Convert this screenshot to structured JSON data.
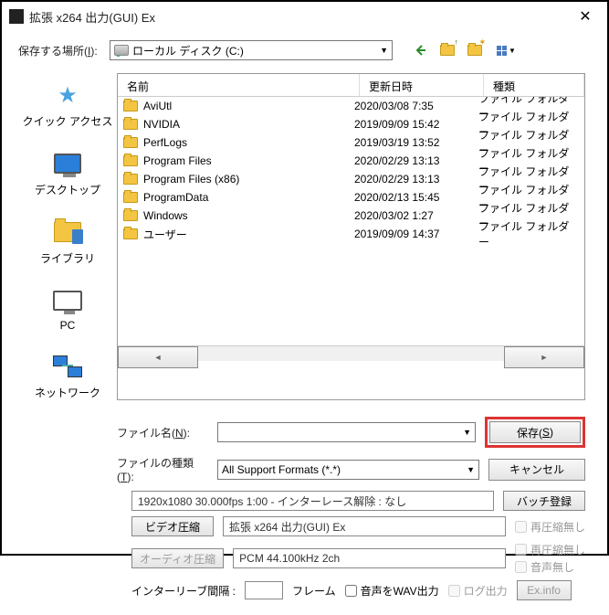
{
  "window": {
    "title": "拡張 x264 出力(GUI) Ex"
  },
  "savein": {
    "label_pre": "保存する場所(",
    "label_key": "I",
    "label_post": "):",
    "drive": "ローカル ディスク (C:)"
  },
  "places": {
    "quick": "クイック アクセス",
    "desktop": "デスクトップ",
    "libraries": "ライブラリ",
    "pc": "PC",
    "network": "ネットワーク"
  },
  "columns": {
    "name": "名前",
    "date": "更新日時",
    "type": "種類"
  },
  "files": [
    {
      "name": "AviUtl",
      "date": "2020/03/08 7:35",
      "type": "ファイル フォルダー"
    },
    {
      "name": "NVIDIA",
      "date": "2019/09/09 15:42",
      "type": "ファイル フォルダー"
    },
    {
      "name": "PerfLogs",
      "date": "2019/03/19 13:52",
      "type": "ファイル フォルダー"
    },
    {
      "name": "Program Files",
      "date": "2020/02/29 13:13",
      "type": "ファイル フォルダー"
    },
    {
      "name": "Program Files (x86)",
      "date": "2020/02/29 13:13",
      "type": "ファイル フォルダー"
    },
    {
      "name": "ProgramData",
      "date": "2020/02/13 15:45",
      "type": "ファイル フォルダー"
    },
    {
      "name": "Windows",
      "date": "2020/03/02 1:27",
      "type": "ファイル フォルダー"
    },
    {
      "name": "ユーザー",
      "date": "2019/09/09 14:37",
      "type": "ファイル フォルダー"
    }
  ],
  "filename": {
    "label_pre": "ファイル名(",
    "label_key": "N",
    "label_post": "):",
    "value": ""
  },
  "filetype": {
    "label_pre": "ファイルの種類(",
    "label_key": "T",
    "label_post": "):",
    "value": "All Support Formats (*.*)"
  },
  "buttons": {
    "save_pre": "保存(",
    "save_key": "S",
    "save_post": ")",
    "cancel": "キャンセル",
    "batch": "バッチ登録",
    "video": "ビデオ圧縮",
    "audio": "オーディオ圧縮",
    "exinfo": "Ex.info"
  },
  "info": {
    "summary": "1920x1080  30.000fps  1:00  -  インターレース解除 : なし"
  },
  "video_codec": "拡張 x264 出力(GUI) Ex",
  "audio_codec": "PCM 44.100kHz 2ch",
  "checks": {
    "recompress_v": "再圧縮無し",
    "recompress_a": "再圧縮無し",
    "no_audio": "音声無し"
  },
  "interleave": {
    "label": "インターリーブ間隔 :",
    "frame": "フレーム",
    "wav_out": "音声をWAV出力",
    "log_out": "ログ出力"
  }
}
